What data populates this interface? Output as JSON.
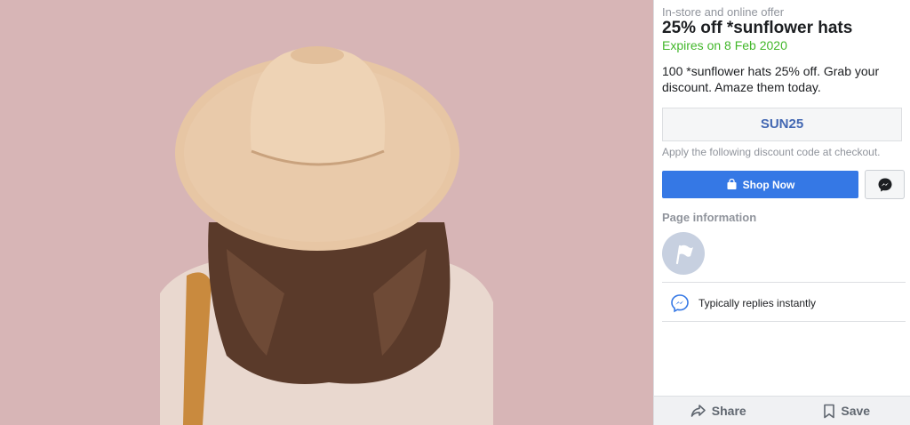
{
  "offer": {
    "eyebrow": "In-store and online offer",
    "title": "25% off *sunflower hats",
    "expiry": "Expires on 8 Feb 2020",
    "description": "100 *sunflower hats 25% off. Grab your discount. Amaze them today.",
    "code": "SUN25",
    "code_hint": "Apply the following discount code at checkout."
  },
  "actions": {
    "shop_now_label": "Shop Now",
    "messenger_icon": "messenger-icon"
  },
  "page_info": {
    "section_title": "Page information",
    "avatar_icon": "flag-icon",
    "reply_text": "Typically replies instantly"
  },
  "footer": {
    "share_label": "Share",
    "save_label": "Save"
  },
  "colors": {
    "accent": "#3578e5",
    "expiry_green": "#42b72a",
    "code_blue": "#4267b2",
    "photo_background": "#d7b5b6"
  }
}
